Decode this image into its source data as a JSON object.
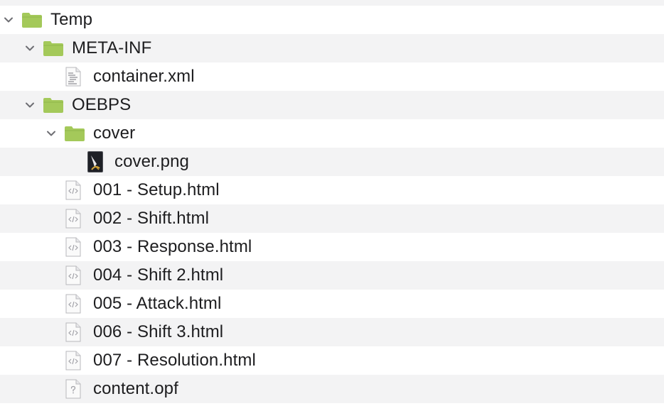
{
  "tree": {
    "items": [
      {
        "label": "Temp",
        "icon": "folder-icon",
        "expanded": true
      },
      {
        "label": "META-INF",
        "icon": "folder-icon",
        "expanded": true
      },
      {
        "label": "container.xml",
        "icon": "xml-document-icon"
      },
      {
        "label": "OEBPS",
        "icon": "folder-icon",
        "expanded": true
      },
      {
        "label": "cover",
        "icon": "folder-icon",
        "expanded": true
      },
      {
        "label": "cover.png",
        "icon": "image-thumbnail-icon"
      },
      {
        "label": "001 - Setup.html",
        "icon": "html-document-icon"
      },
      {
        "label": "002 - Shift.html",
        "icon": "html-document-icon"
      },
      {
        "label": "003 - Response.html",
        "icon": "html-document-icon"
      },
      {
        "label": "004 - Shift 2.html",
        "icon": "html-document-icon"
      },
      {
        "label": "005 - Attack.html",
        "icon": "html-document-icon"
      },
      {
        "label": "006 - Shift 3.html",
        "icon": "html-document-icon"
      },
      {
        "label": "007 - Resolution.html",
        "icon": "html-document-icon"
      },
      {
        "label": "content.opf",
        "icon": "unknown-document-icon"
      }
    ]
  },
  "colors": {
    "folder": "#a4c95a",
    "folder_dark": "#8fb84a",
    "stripe": "#f3f3f4",
    "text": "#1d1d1f",
    "chevron": "#6e6e73"
  }
}
